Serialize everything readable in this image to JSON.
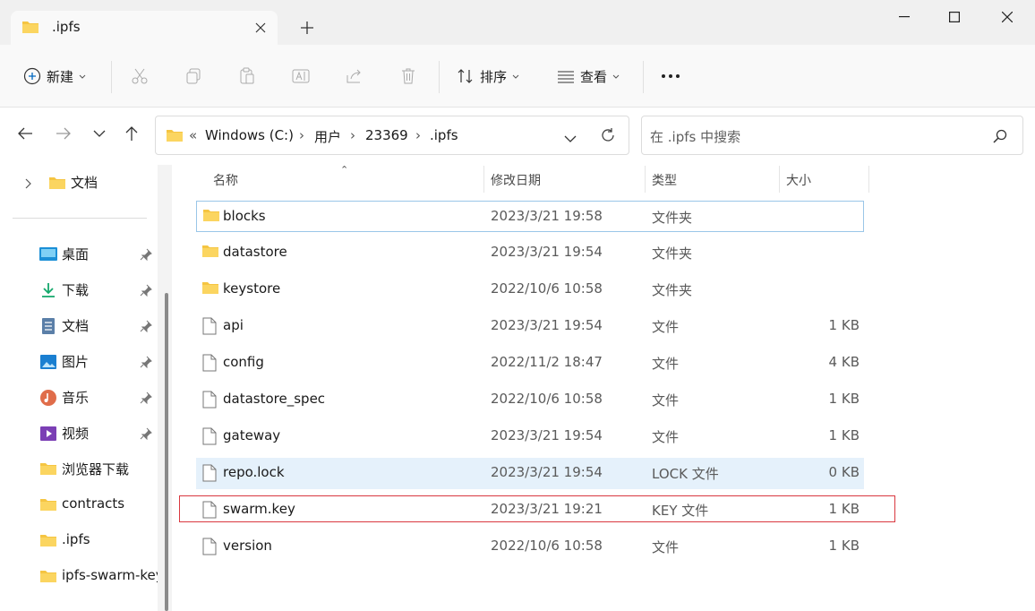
{
  "window": {
    "tab_title": ".ipfs"
  },
  "toolbar": {
    "new_label": "新建",
    "sort_label": "排序",
    "view_label": "查看"
  },
  "address": {
    "overflow": "«",
    "crumbs": [
      "Windows (C:)",
      "用户",
      "23369",
      ".ipfs"
    ],
    "search_placeholder": "在 .ipfs 中搜索"
  },
  "sidebar": {
    "tree_root": "文档",
    "quick_access": [
      {
        "label": "桌面",
        "icon": "desktop-icon",
        "pinned": true
      },
      {
        "label": "下载",
        "icon": "download-icon",
        "pinned": true
      },
      {
        "label": "文档",
        "icon": "document-icon",
        "pinned": true
      },
      {
        "label": "图片",
        "icon": "pictures-icon",
        "pinned": true
      },
      {
        "label": "音乐",
        "icon": "music-icon",
        "pinned": true
      },
      {
        "label": "视频",
        "icon": "video-icon",
        "pinned": true
      },
      {
        "label": "浏览器下载",
        "icon": "folder-icon",
        "pinned": false
      },
      {
        "label": "contracts",
        "icon": "folder-icon",
        "pinned": false
      },
      {
        "label": ".ipfs",
        "icon": "folder-icon",
        "pinned": false
      },
      {
        "label": "ipfs-swarm-key",
        "icon": "folder-icon",
        "pinned": false
      }
    ]
  },
  "columns": {
    "name": "名称",
    "modified": "修改日期",
    "type": "类型",
    "size": "大小"
  },
  "files": [
    {
      "name": "blocks",
      "modified": "2023/3/21 19:58",
      "type": "文件夹",
      "size": "",
      "kind": "folder"
    },
    {
      "name": "datastore",
      "modified": "2023/3/21 19:54",
      "type": "文件夹",
      "size": "",
      "kind": "folder"
    },
    {
      "name": "keystore",
      "modified": "2022/10/6 10:58",
      "type": "文件夹",
      "size": "",
      "kind": "folder"
    },
    {
      "name": "api",
      "modified": "2023/3/21 19:54",
      "type": "文件",
      "size": "1 KB",
      "kind": "file"
    },
    {
      "name": "config",
      "modified": "2022/11/2 18:47",
      "type": "文件",
      "size": "4 KB",
      "kind": "file"
    },
    {
      "name": "datastore_spec",
      "modified": "2022/10/6 10:58",
      "type": "文件",
      "size": "1 KB",
      "kind": "file"
    },
    {
      "name": "gateway",
      "modified": "2023/3/21 19:54",
      "type": "文件",
      "size": "1 KB",
      "kind": "file"
    },
    {
      "name": "repo.lock",
      "modified": "2023/3/21 19:54",
      "type": "LOCK 文件",
      "size": "0 KB",
      "kind": "file"
    },
    {
      "name": "swarm.key",
      "modified": "2023/3/21 19:21",
      "type": "KEY 文件",
      "size": "1 KB",
      "kind": "file"
    },
    {
      "name": "version",
      "modified": "2022/10/6 10:58",
      "type": "文件",
      "size": "1 KB",
      "kind": "file"
    }
  ],
  "colors": {
    "folder": "#f5c542",
    "accent": "#0067c0",
    "highlight_box": "#d9383f",
    "hover_row": "#e5f1fb"
  }
}
